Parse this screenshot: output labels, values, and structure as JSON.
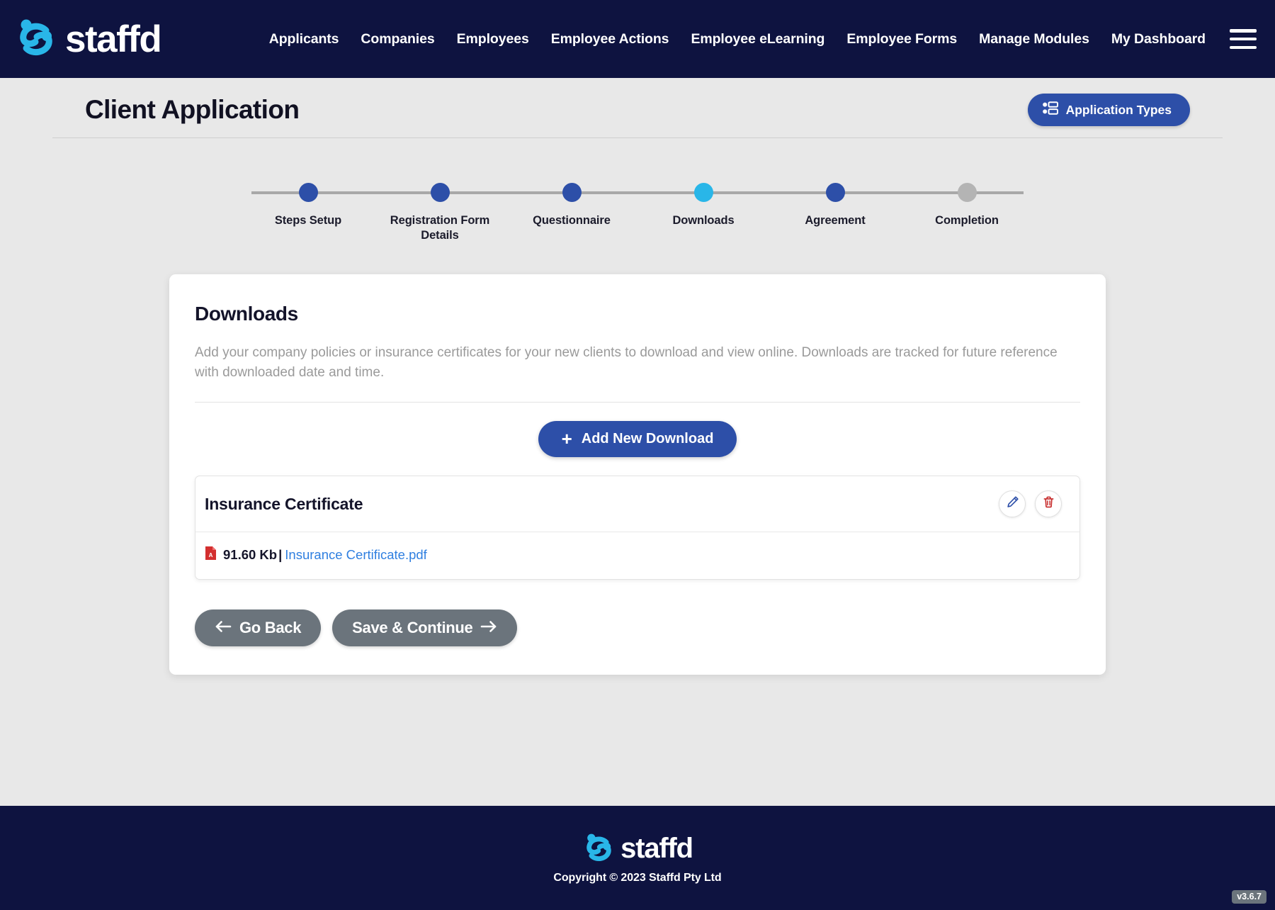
{
  "brand": {
    "name": "staffd",
    "logo_icon": "staffd-swirl-logo",
    "logo_color": "#29b6e8"
  },
  "nav": {
    "items": [
      {
        "label": "Applicants"
      },
      {
        "label": "Companies"
      },
      {
        "label": "Employees"
      },
      {
        "label": "Employee Actions"
      },
      {
        "label": "Employee eLearning"
      },
      {
        "label": "Employee Forms"
      },
      {
        "label": "Manage Modules"
      },
      {
        "label": "My Dashboard"
      }
    ],
    "menu_icon": "hamburger-menu-icon"
  },
  "header": {
    "title": "Client Application",
    "application_types_button": {
      "label": "Application Types",
      "icon": "list-people-icon",
      "color": "#2d4fa8"
    }
  },
  "stepper": {
    "active_color": "#29b6e8",
    "complete_color": "#2d4fa8",
    "pending_color": "#b4b4b4",
    "steps": [
      {
        "label": "Steps Setup",
        "state": "complete"
      },
      {
        "label": "Registration Form Details",
        "state": "complete"
      },
      {
        "label": "Questionnaire",
        "state": "complete"
      },
      {
        "label": "Downloads",
        "state": "active"
      },
      {
        "label": "Agreement",
        "state": "complete"
      },
      {
        "label": "Completion",
        "state": "pending"
      }
    ]
  },
  "card": {
    "title": "Downloads",
    "description": "Add your company policies or insurance certificates for your new clients to download and view online. Downloads are tracked for future reference with downloaded date and time.",
    "add_button": {
      "label": "Add New Download",
      "icon": "plus-icon"
    },
    "downloads": [
      {
        "name": "Insurance Certificate",
        "edit_icon": "pencil-edit-icon",
        "delete_icon": "trash-delete-icon",
        "file_icon": "pdf-file-icon",
        "file_size": "91.60 Kb",
        "separator": "|",
        "file_name": "Insurance Certificate.pdf",
        "file_link_color": "#2f7fe0"
      }
    ],
    "go_back_button": {
      "label": "Go Back",
      "icon": "arrow-left-icon"
    },
    "save_continue_button": {
      "label": "Save & Continue",
      "icon": "arrow-right-icon"
    }
  },
  "footer": {
    "brand_name": "staffd",
    "copyright": "Copyright © 2023 Staffd Pty Ltd",
    "version": "v3.6.7"
  }
}
